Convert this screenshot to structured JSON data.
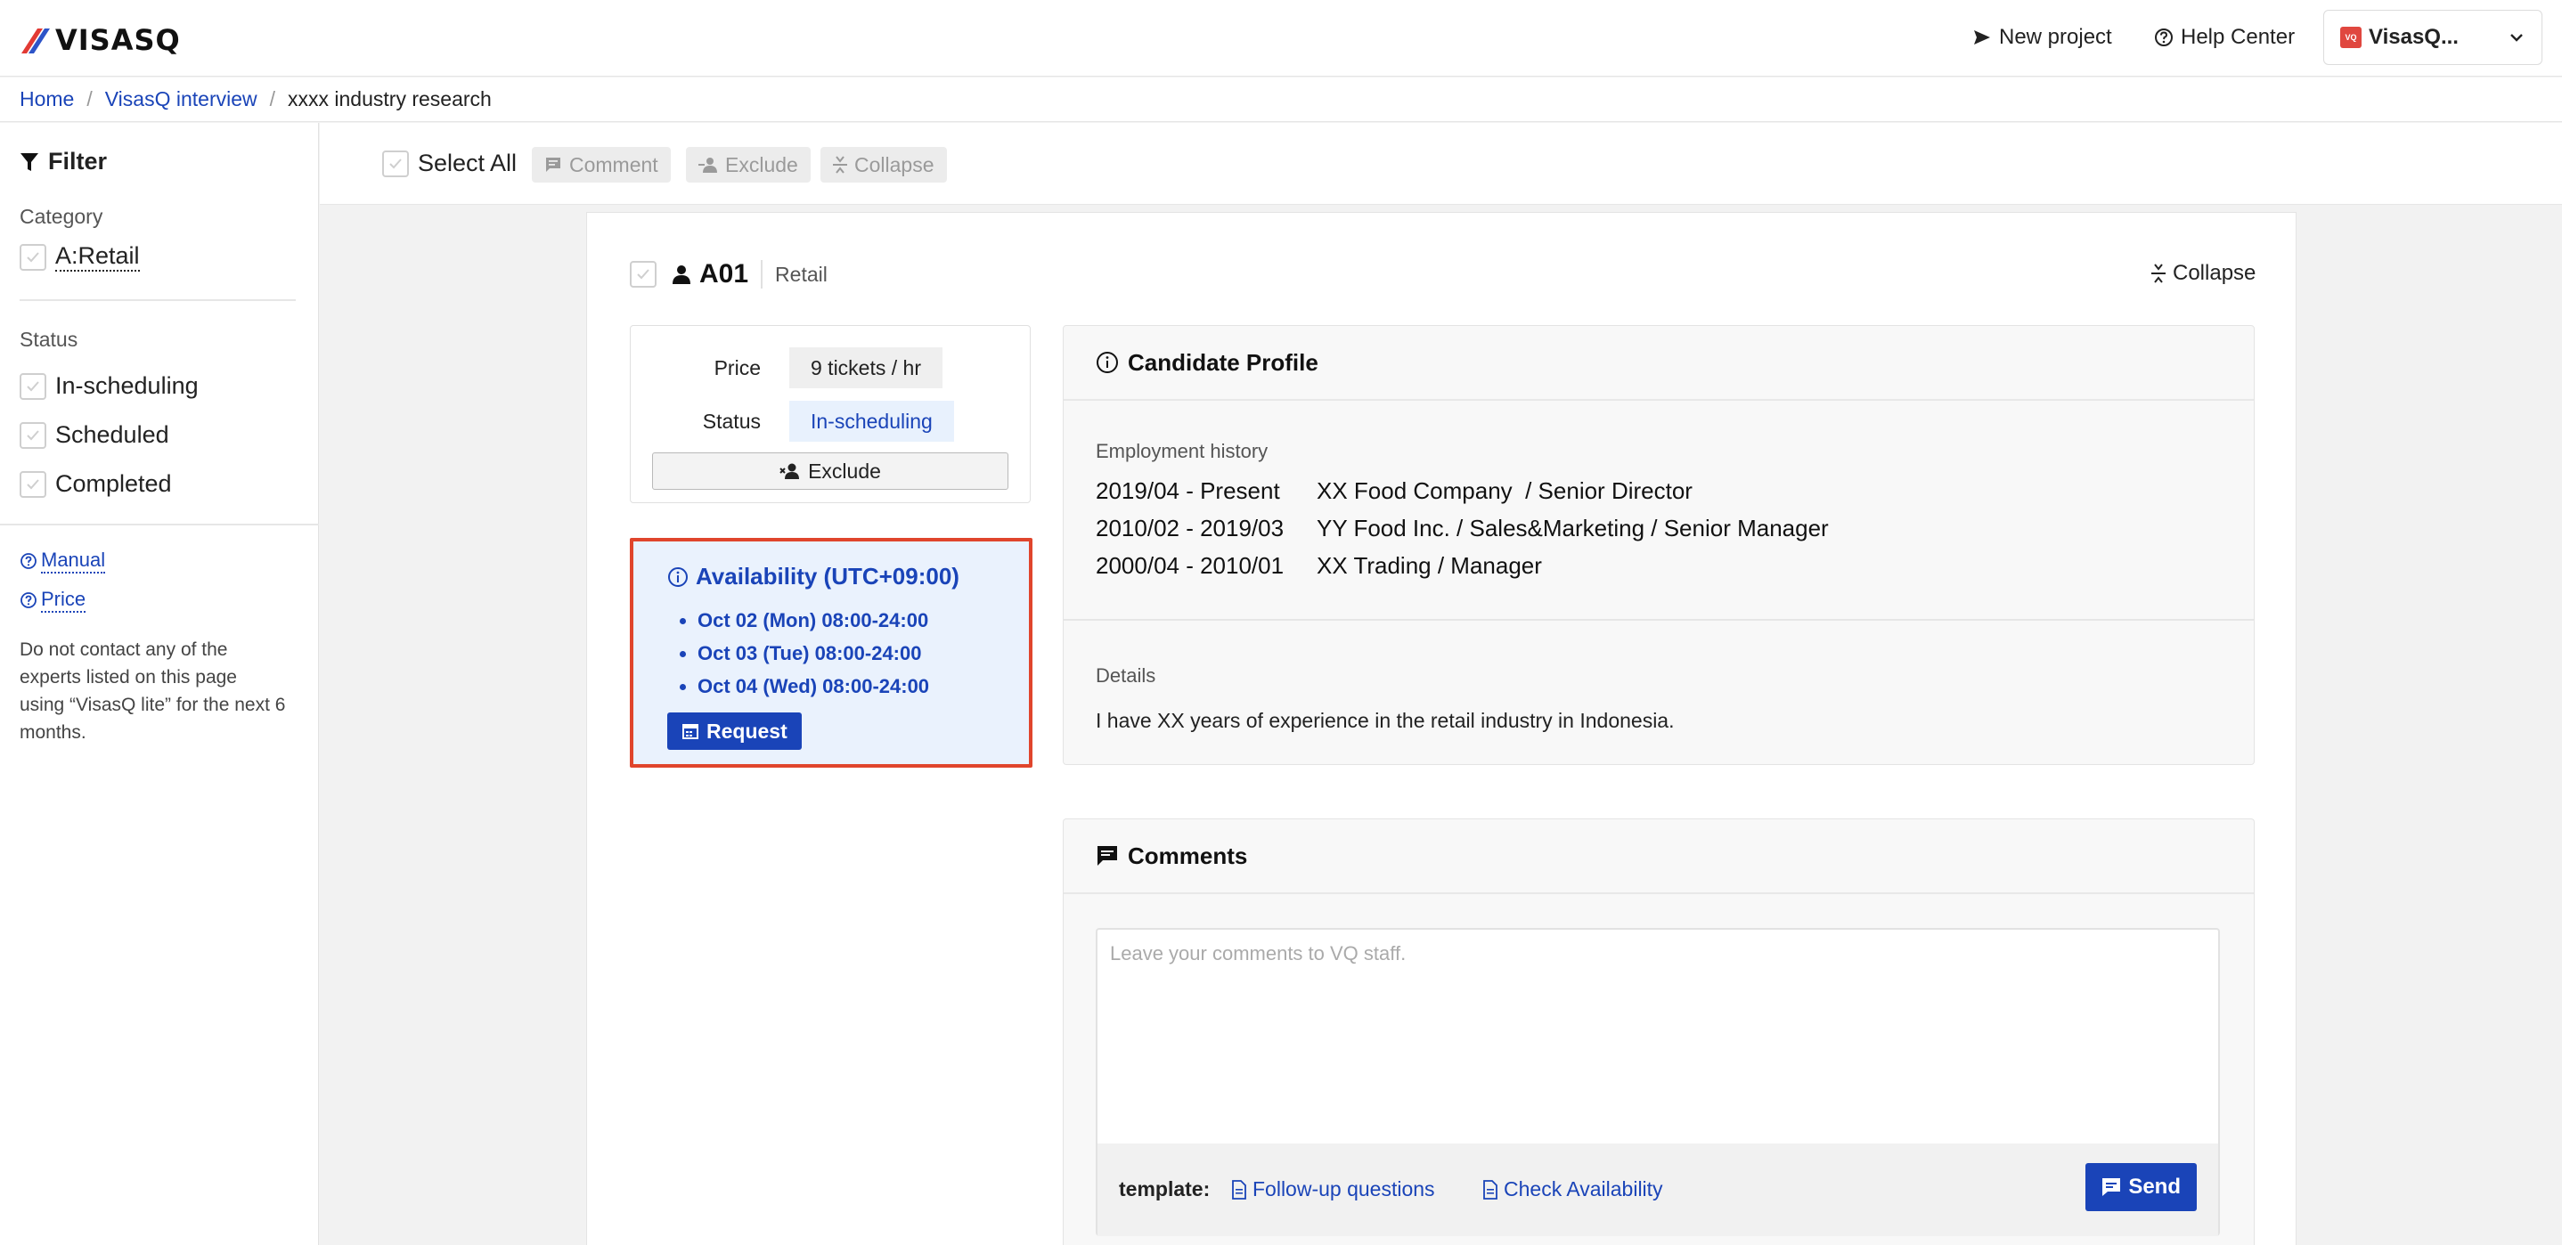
{
  "header": {
    "logo_text": "VISASQ",
    "new_project": "New project",
    "help_center": "Help Center",
    "account_name": "VisasQ...",
    "account_logo_text": "VQ"
  },
  "breadcrumb": {
    "home": "Home",
    "interview": "VisasQ interview",
    "current": "xxxx industry research",
    "separator": "/"
  },
  "sidebar": {
    "filter_title": "Filter",
    "category_label": "Category",
    "categories": [
      "A:Retail"
    ],
    "status_label": "Status",
    "statuses": [
      "In-scheduling",
      "Scheduled",
      "Completed"
    ],
    "manual_link": "Manual",
    "price_link": "Price",
    "note": "Do not contact any of the experts listed on this page using “VisasQ lite” for the next 6 months."
  },
  "toolbar": {
    "select_all": "Select All",
    "comment": "Comment",
    "exclude": "Exclude",
    "collapse": "Collapse"
  },
  "expert": {
    "id": "A01",
    "category": "Retail",
    "collapse": "Collapse",
    "price_label": "Price",
    "price_value": "9 tickets / hr",
    "status_label": "Status",
    "status_value": "In-scheduling",
    "exclude": "Exclude"
  },
  "availability": {
    "title": "Availability (UTC+09:00)",
    "slots": [
      "Oct 02 (Mon) 08:00-24:00",
      "Oct 03 (Tue) 08:00-24:00",
      "Oct 04 (Wed) 08:00-24:00"
    ],
    "request": "Request"
  },
  "profile": {
    "title": "Candidate Profile",
    "employment_label": "Employment history",
    "employment": [
      {
        "period": "2019/04 - Present",
        "desc": "XX Food Company  / Senior Director"
      },
      {
        "period": "2010/02 - 2019/03",
        "desc": "YY Food Inc. / Sales&Marketing / Senior Manager"
      },
      {
        "period": "2000/04 - 2010/01",
        "desc": "XX Trading / Manager"
      }
    ],
    "details_label": "Details",
    "details": "I have XX years of experience in the retail industry in Indonesia."
  },
  "comments": {
    "title": "Comments",
    "placeholder": "Leave your comments to VQ staff.",
    "template_label": "template:",
    "template_followup": "Follow-up questions",
    "template_availability": "Check Availability",
    "send": "Send"
  },
  "colors": {
    "accent": "#1a44b8",
    "highlight_border": "#e0452c",
    "availability_bg": "#eaf2fd"
  }
}
